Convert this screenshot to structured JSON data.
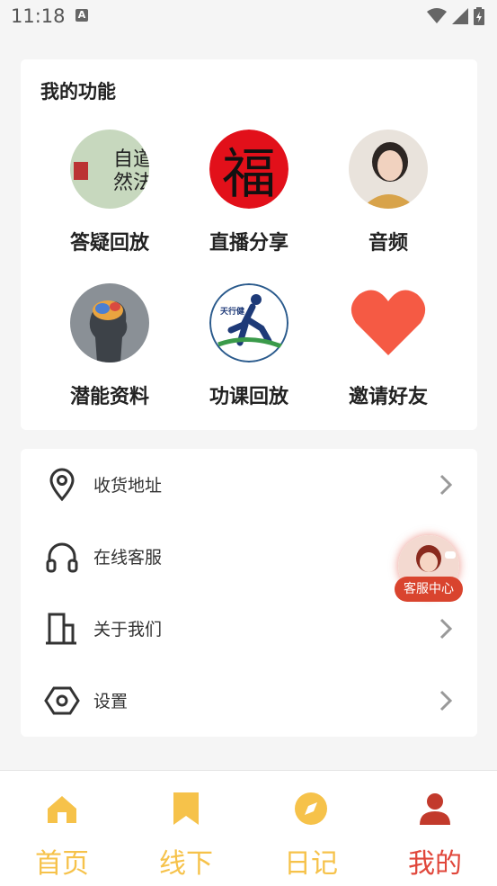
{
  "status": {
    "time": "11:18",
    "notification_badge": "A"
  },
  "functions": {
    "title": "我的功能",
    "items": [
      {
        "label": "答疑回放",
        "icon": "calligraphy-icon"
      },
      {
        "label": "直播分享",
        "icon": "fu-character-icon"
      },
      {
        "label": "音频",
        "icon": "woman-avatar-icon"
      },
      {
        "label": "潜能资料",
        "icon": "brain-icon"
      },
      {
        "label": "功课回放",
        "icon": "runner-icon"
      },
      {
        "label": "邀请好友",
        "icon": "heart-icon"
      }
    ],
    "calligraphy_text": "自道\n然法",
    "fu_char": "福",
    "runner_text": "天行健"
  },
  "menu": {
    "items": [
      {
        "label": "收货地址",
        "icon": "location-pin-icon"
      },
      {
        "label": "在线客服",
        "icon": "headphones-icon"
      },
      {
        "label": "关于我们",
        "icon": "building-icon"
      },
      {
        "label": "设置",
        "icon": "hexagon-settings-icon"
      }
    ]
  },
  "floating_service": {
    "label": "客服中心"
  },
  "tabbar": {
    "tabs": [
      {
        "label": "首页",
        "icon": "home-icon",
        "color": "#f6c24a"
      },
      {
        "label": "线下",
        "icon": "bookmark-icon",
        "color": "#f6c24a"
      },
      {
        "label": "日记",
        "icon": "compass-icon",
        "color": "#f6c24a"
      },
      {
        "label": "我的",
        "icon": "user-icon",
        "color": "#e0463a",
        "active": true
      }
    ]
  },
  "colors": {
    "accent_yellow": "#f6c24a",
    "active_red": "#e0463a",
    "heart_red": "#f55a44"
  }
}
